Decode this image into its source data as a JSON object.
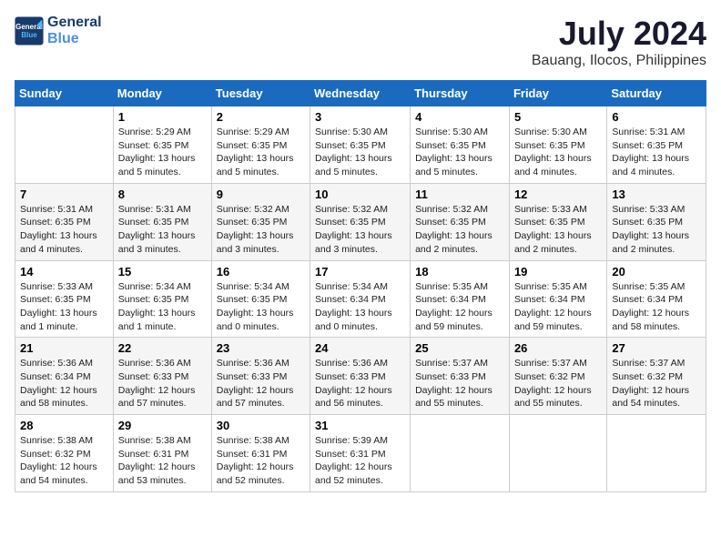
{
  "logo": {
    "line1": "General",
    "line2": "Blue"
  },
  "title": "July 2024",
  "location": "Bauang, Ilocos, Philippines",
  "days_of_week": [
    "Sunday",
    "Monday",
    "Tuesday",
    "Wednesday",
    "Thursday",
    "Friday",
    "Saturday"
  ],
  "weeks": [
    [
      {
        "day": "",
        "info": ""
      },
      {
        "day": "1",
        "info": "Sunrise: 5:29 AM\nSunset: 6:35 PM\nDaylight: 13 hours\nand 5 minutes."
      },
      {
        "day": "2",
        "info": "Sunrise: 5:29 AM\nSunset: 6:35 PM\nDaylight: 13 hours\nand 5 minutes."
      },
      {
        "day": "3",
        "info": "Sunrise: 5:30 AM\nSunset: 6:35 PM\nDaylight: 13 hours\nand 5 minutes."
      },
      {
        "day": "4",
        "info": "Sunrise: 5:30 AM\nSunset: 6:35 PM\nDaylight: 13 hours\nand 5 minutes."
      },
      {
        "day": "5",
        "info": "Sunrise: 5:30 AM\nSunset: 6:35 PM\nDaylight: 13 hours\nand 4 minutes."
      },
      {
        "day": "6",
        "info": "Sunrise: 5:31 AM\nSunset: 6:35 PM\nDaylight: 13 hours\nand 4 minutes."
      }
    ],
    [
      {
        "day": "7",
        "info": "Sunrise: 5:31 AM\nSunset: 6:35 PM\nDaylight: 13 hours\nand 4 minutes."
      },
      {
        "day": "8",
        "info": "Sunrise: 5:31 AM\nSunset: 6:35 PM\nDaylight: 13 hours\nand 3 minutes."
      },
      {
        "day": "9",
        "info": "Sunrise: 5:32 AM\nSunset: 6:35 PM\nDaylight: 13 hours\nand 3 minutes."
      },
      {
        "day": "10",
        "info": "Sunrise: 5:32 AM\nSunset: 6:35 PM\nDaylight: 13 hours\nand 3 minutes."
      },
      {
        "day": "11",
        "info": "Sunrise: 5:32 AM\nSunset: 6:35 PM\nDaylight: 13 hours\nand 2 minutes."
      },
      {
        "day": "12",
        "info": "Sunrise: 5:33 AM\nSunset: 6:35 PM\nDaylight: 13 hours\nand 2 minutes."
      },
      {
        "day": "13",
        "info": "Sunrise: 5:33 AM\nSunset: 6:35 PM\nDaylight: 13 hours\nand 2 minutes."
      }
    ],
    [
      {
        "day": "14",
        "info": "Sunrise: 5:33 AM\nSunset: 6:35 PM\nDaylight: 13 hours\nand 1 minute."
      },
      {
        "day": "15",
        "info": "Sunrise: 5:34 AM\nSunset: 6:35 PM\nDaylight: 13 hours\nand 1 minute."
      },
      {
        "day": "16",
        "info": "Sunrise: 5:34 AM\nSunset: 6:35 PM\nDaylight: 13 hours\nand 0 minutes."
      },
      {
        "day": "17",
        "info": "Sunrise: 5:34 AM\nSunset: 6:34 PM\nDaylight: 13 hours\nand 0 minutes."
      },
      {
        "day": "18",
        "info": "Sunrise: 5:35 AM\nSunset: 6:34 PM\nDaylight: 12 hours\nand 59 minutes."
      },
      {
        "day": "19",
        "info": "Sunrise: 5:35 AM\nSunset: 6:34 PM\nDaylight: 12 hours\nand 59 minutes."
      },
      {
        "day": "20",
        "info": "Sunrise: 5:35 AM\nSunset: 6:34 PM\nDaylight: 12 hours\nand 58 minutes."
      }
    ],
    [
      {
        "day": "21",
        "info": "Sunrise: 5:36 AM\nSunset: 6:34 PM\nDaylight: 12 hours\nand 58 minutes."
      },
      {
        "day": "22",
        "info": "Sunrise: 5:36 AM\nSunset: 6:33 PM\nDaylight: 12 hours\nand 57 minutes."
      },
      {
        "day": "23",
        "info": "Sunrise: 5:36 AM\nSunset: 6:33 PM\nDaylight: 12 hours\nand 57 minutes."
      },
      {
        "day": "24",
        "info": "Sunrise: 5:36 AM\nSunset: 6:33 PM\nDaylight: 12 hours\nand 56 minutes."
      },
      {
        "day": "25",
        "info": "Sunrise: 5:37 AM\nSunset: 6:33 PM\nDaylight: 12 hours\nand 55 minutes."
      },
      {
        "day": "26",
        "info": "Sunrise: 5:37 AM\nSunset: 6:32 PM\nDaylight: 12 hours\nand 55 minutes."
      },
      {
        "day": "27",
        "info": "Sunrise: 5:37 AM\nSunset: 6:32 PM\nDaylight: 12 hours\nand 54 minutes."
      }
    ],
    [
      {
        "day": "28",
        "info": "Sunrise: 5:38 AM\nSunset: 6:32 PM\nDaylight: 12 hours\nand 54 minutes."
      },
      {
        "day": "29",
        "info": "Sunrise: 5:38 AM\nSunset: 6:31 PM\nDaylight: 12 hours\nand 53 minutes."
      },
      {
        "day": "30",
        "info": "Sunrise: 5:38 AM\nSunset: 6:31 PM\nDaylight: 12 hours\nand 52 minutes."
      },
      {
        "day": "31",
        "info": "Sunrise: 5:39 AM\nSunset: 6:31 PM\nDaylight: 12 hours\nand 52 minutes."
      },
      {
        "day": "",
        "info": ""
      },
      {
        "day": "",
        "info": ""
      },
      {
        "day": "",
        "info": ""
      }
    ]
  ]
}
